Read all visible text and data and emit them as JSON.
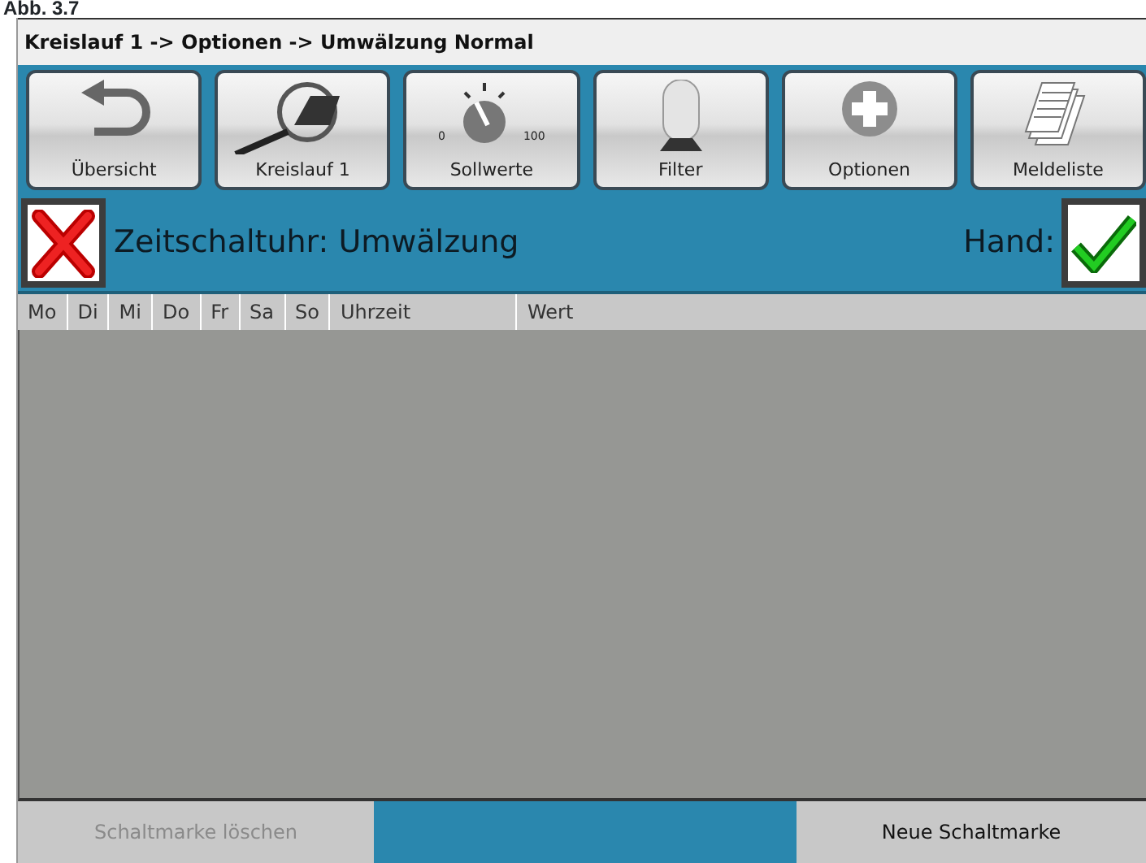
{
  "caption": "Abb. 3.7",
  "window": {
    "title": "Kreislauf 1 -> Optionen -> Umwälzung Normal"
  },
  "toolbar": [
    {
      "label": "Übersicht"
    },
    {
      "label": "Kreislauf 1"
    },
    {
      "label": "Sollwerte",
      "dial_min": "0",
      "dial_max": "100"
    },
    {
      "label": "Filter"
    },
    {
      "label": "Optionen"
    },
    {
      "label": "Meldeliste"
    }
  ],
  "timer": {
    "title": "Zeitschaltuhr: Umwälzung",
    "hand_label": "Hand:",
    "hand_checked": true
  },
  "table": {
    "columns": [
      "Mo",
      "Di",
      "Mi",
      "Do",
      "Fr",
      "Sa",
      "So",
      "Uhrzeit",
      "Wert"
    ]
  },
  "buttons": [
    {
      "label": "Schaltmarke löschen",
      "disabled": true
    },
    {
      "label": "Neue Schaltmarke",
      "disabled": false
    }
  ]
}
